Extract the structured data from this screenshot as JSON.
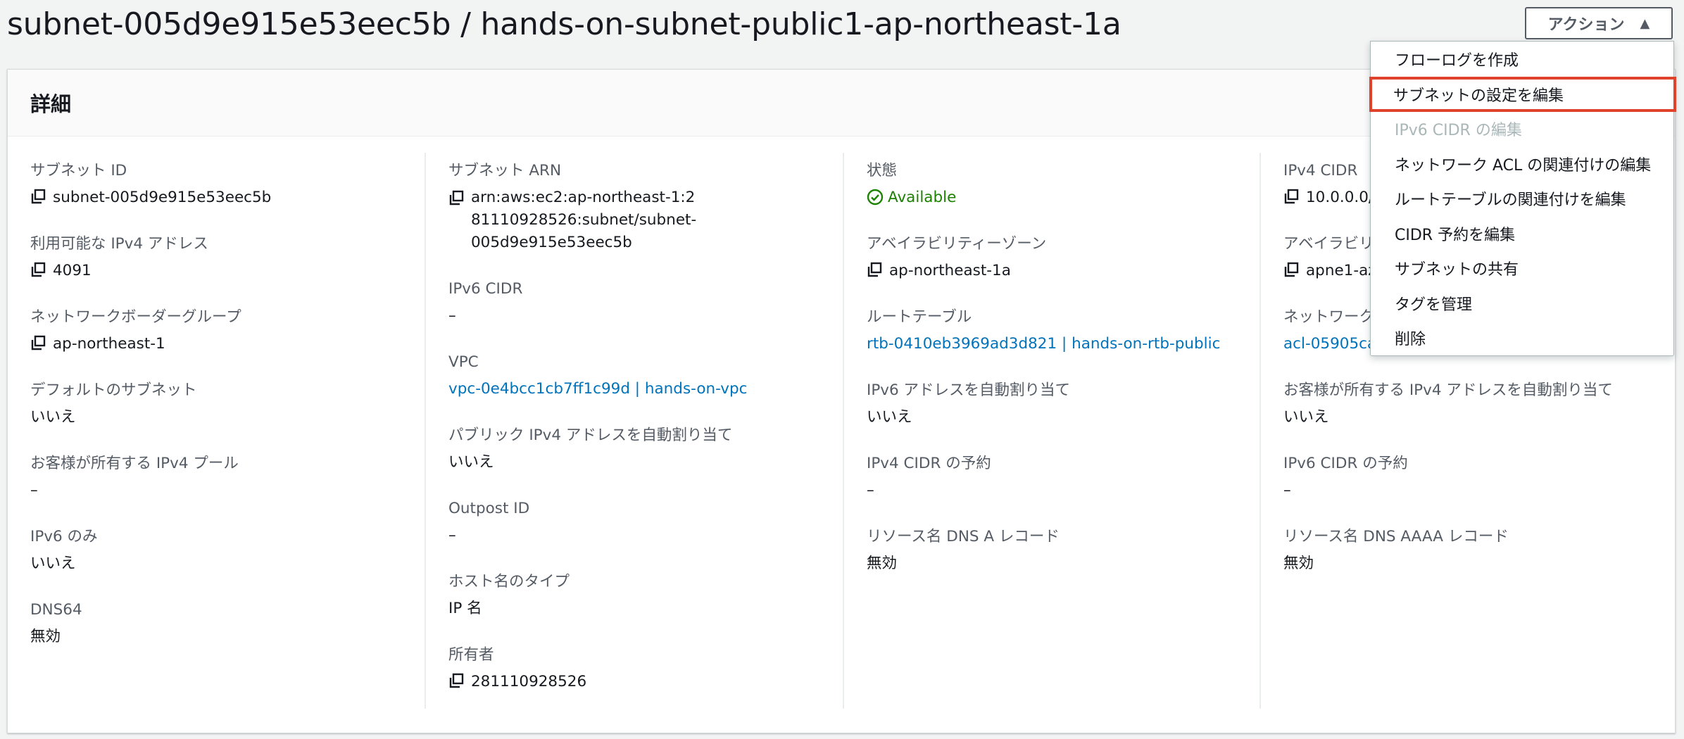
{
  "page_title": "subnet-005d9e915e53eec5b / hands-on-subnet-public1-ap-northeast-1a",
  "actions": {
    "label": "アクション"
  },
  "panel": {
    "title": "詳細"
  },
  "col1": [
    {
      "label": "サブネット ID",
      "value": "subnet-005d9e915e53eec5b"
    },
    {
      "label": "利用可能な IPv4 アドレス",
      "value": "4091"
    },
    {
      "label": "ネットワークボーダーグループ",
      "value": "ap-northeast-1"
    },
    {
      "label": "デフォルトのサブネット",
      "value": "いいえ"
    },
    {
      "label": "お客様が所有する IPv4 プール",
      "value": "–"
    },
    {
      "label": "IPv6 のみ",
      "value": "いいえ"
    },
    {
      "label": "DNS64",
      "value": "無効"
    }
  ],
  "col2": [
    {
      "label": "サブネット ARN",
      "value": "arn:aws:ec2:ap-northeast-1:281110928526:subnet/subnet-005d9e915e53eec5b"
    },
    {
      "label": "IPv6 CIDR",
      "value": "–"
    },
    {
      "label": "VPC",
      "value": "vpc-0e4bcc1cb7ff1c99d | hands-on-vpc"
    },
    {
      "label": "パブリック IPv4 アドレスを自動割り当て",
      "value": "いいえ"
    },
    {
      "label": "Outpost ID",
      "value": "–"
    },
    {
      "label": "ホスト名のタイプ",
      "value": "IP 名"
    },
    {
      "label": "所有者",
      "value": "281110928526"
    }
  ],
  "col3": [
    {
      "label": "状態",
      "value": "Available"
    },
    {
      "label": "アベイラビリティーゾーン",
      "value": "ap-northeast-1a"
    },
    {
      "label": "ルートテーブル",
      "value": "rtb-0410eb3969ad3d821 | hands-on-rtb-public"
    },
    {
      "label": "IPv6 アドレスを自動割り当て",
      "value": "いいえ"
    },
    {
      "label": "IPv4 CIDR の予約",
      "value": "–"
    },
    {
      "label": "リソース名 DNS A レコード",
      "value": "無効"
    }
  ],
  "col4": [
    {
      "label": "IPv4 CIDR",
      "value": "10.0.0.0/"
    },
    {
      "label": "アベイラビリ",
      "value": "apne1-az"
    },
    {
      "label": "ネットワーク",
      "value": "acl-05905ca"
    },
    {
      "label": "お客様が所有する IPv4 アドレスを自動割り当て",
      "value": "いいえ"
    },
    {
      "label": "IPv6 CIDR の予約",
      "value": "–"
    },
    {
      "label": "リソース名 DNS AAAA レコード",
      "value": "無効"
    }
  ],
  "menu": [
    {
      "label": "フローログを作成"
    },
    {
      "label": "サブネットの設定を編集"
    },
    {
      "label": "IPv6 CIDR の編集"
    },
    {
      "label": "ネットワーク ACL の関連付けの編集"
    },
    {
      "label": "ルートテーブルの関連付けを編集"
    },
    {
      "label": "CIDR 予約を編集"
    },
    {
      "label": "サブネットの共有"
    },
    {
      "label": "タグを管理"
    },
    {
      "label": "削除"
    }
  ],
  "colors": {
    "link": "#0073bb",
    "success": "#1d8102",
    "highlight": "#e0432c"
  }
}
